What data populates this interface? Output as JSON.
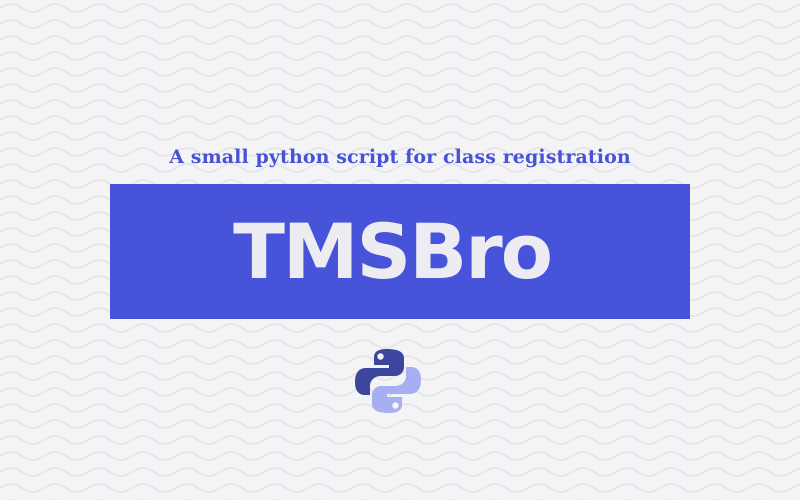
{
  "subtitle": "A small python script for class registration",
  "title": "TMSBro",
  "logo": {
    "icon": "python-logo-icon"
  },
  "colors": {
    "background": "#f4f4f6",
    "accent": "#4753d9",
    "title_text": "#ececf2",
    "logo_top": "#3d469e",
    "logo_bottom": "#a7aff0"
  }
}
